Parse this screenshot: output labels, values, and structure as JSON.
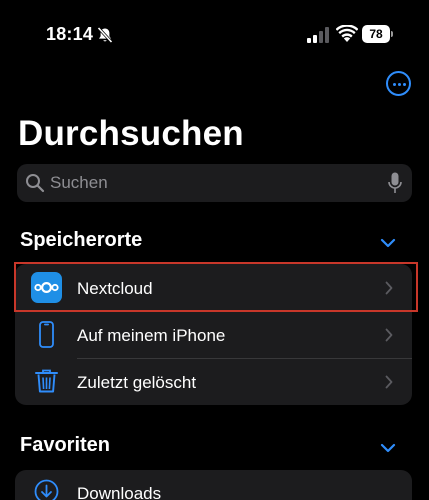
{
  "status_bar": {
    "time": "18:14",
    "battery": "78"
  },
  "header": {
    "title": "Durchsuchen",
    "more_icon": "ellipsis-circle-icon"
  },
  "search": {
    "placeholder": "Suchen"
  },
  "locations": {
    "title": "Speicherorte",
    "items": [
      {
        "label": "Nextcloud",
        "icon": "nextcloud-logo"
      },
      {
        "label": "Auf meinem iPhone",
        "icon": "iphone-icon"
      },
      {
        "label": "Zuletzt gelöscht",
        "icon": "trash-icon"
      }
    ]
  },
  "favorites": {
    "title": "Favoriten",
    "items": [
      {
        "label": "Downloads",
        "icon": "download-circle-icon"
      }
    ]
  },
  "colors": {
    "accent": "#2f8dfb",
    "background": "#000000",
    "card": "#1c1c1e",
    "highlight": "#c8372a"
  }
}
